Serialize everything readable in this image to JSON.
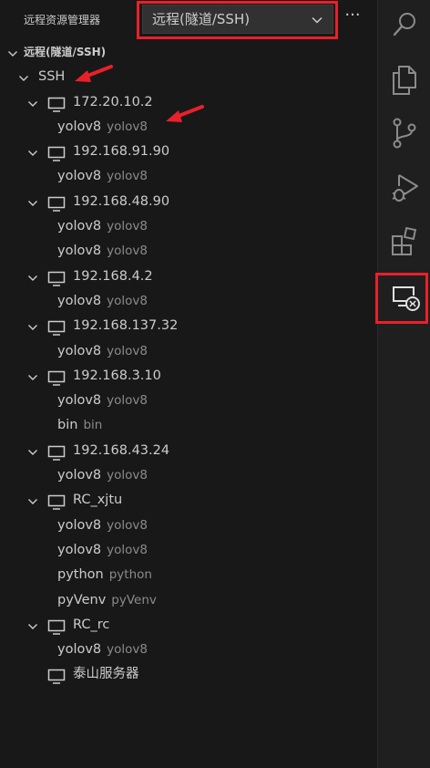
{
  "header": {
    "title": "远程资源管理器",
    "dropdown_value": "远程(隧道/SSH)"
  },
  "section": {
    "label": "远程(隧道/SSH)"
  },
  "group": {
    "label": "SSH"
  },
  "hosts": [
    {
      "name": "172.20.10.2",
      "folders": [
        {
          "label": "yolov8",
          "desc": "yolov8"
        }
      ]
    },
    {
      "name": "192.168.91.90",
      "folders": [
        {
          "label": "yolov8",
          "desc": "yolov8"
        }
      ]
    },
    {
      "name": "192.168.48.90",
      "folders": [
        {
          "label": "yolov8",
          "desc": "yolov8"
        },
        {
          "label": "yolov8",
          "desc": "yolov8"
        }
      ]
    },
    {
      "name": "192.168.4.2",
      "folders": [
        {
          "label": "yolov8",
          "desc": "yolov8"
        }
      ]
    },
    {
      "name": "192.168.137.32",
      "folders": [
        {
          "label": "yolov8",
          "desc": "yolov8"
        }
      ]
    },
    {
      "name": "192.168.3.10",
      "folders": [
        {
          "label": "yolov8",
          "desc": "yolov8"
        },
        {
          "label": "bin",
          "desc": "bin"
        }
      ]
    },
    {
      "name": "192.168.43.24",
      "folders": [
        {
          "label": "yolov8",
          "desc": "yolov8"
        }
      ]
    },
    {
      "name": "RC_xjtu",
      "folders": [
        {
          "label": "yolov8",
          "desc": "yolov8"
        },
        {
          "label": "yolov8",
          "desc": "yolov8"
        },
        {
          "label": "python",
          "desc": "python"
        },
        {
          "label": "pyVenv",
          "desc": "pyVenv"
        }
      ]
    },
    {
      "name": "RC_rc",
      "folders": [
        {
          "label": "yolov8",
          "desc": "yolov8"
        }
      ]
    },
    {
      "name": "泰山服务器",
      "folders": []
    }
  ],
  "activity_bar": [
    "search-icon",
    "explorer-icon",
    "source-control-icon",
    "run-debug-icon",
    "extensions-icon",
    "remote-explorer-icon"
  ],
  "colors": {
    "annotation": "#e8202a",
    "background": "#181818",
    "description": "#8b8b8b"
  }
}
